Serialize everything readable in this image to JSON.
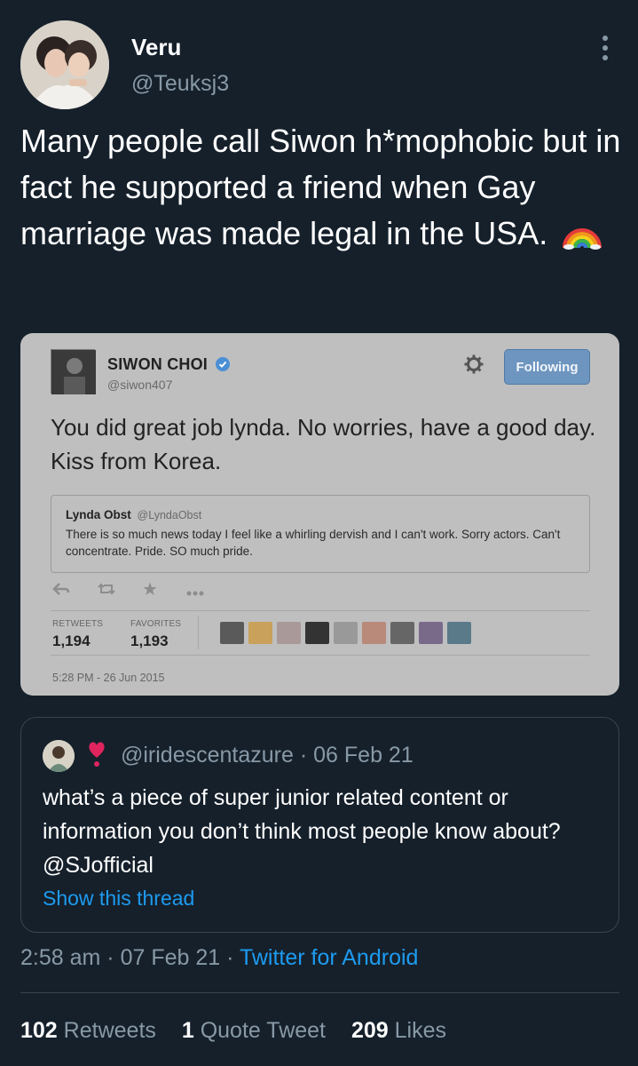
{
  "author": {
    "display_name": "Veru",
    "handle": "@Teuksj3",
    "avatar_icon": "profile-photo-icon"
  },
  "tweet": {
    "text": "Many people call Siwon h*mophobic but in fact he supported a friend when Gay marriage was made legal in the USA.",
    "emoji": "rainbow-icon"
  },
  "embedded_screenshot": {
    "name": "SIWON CHOI",
    "handle": "@siwon407",
    "follow_label": "Following",
    "text": "You did great job lynda. No worries, have a good day. Kiss from Korea.",
    "quote": {
      "name": "Lynda Obst",
      "handle": "@LyndaObst",
      "text": "There is so much news today I feel like a whirling dervish and I can't work. Sorry actors. Can't concentrate. Pride. SO much pride."
    },
    "retweets_label": "RETWEETS",
    "retweets_value": "1,194",
    "favorites_label": "FAVORITES",
    "favorites_value": "1,193",
    "timestamp": "5:28 PM - 26 Jun 2015",
    "face_colors": [
      "#5a5a5a",
      "#c9a15a",
      "#a99",
      "#333",
      "#999",
      "#b9897a",
      "#666",
      "#7a6a8a",
      "#5a7a8a"
    ]
  },
  "quoted_tweet": {
    "handle": "@iridescentazure",
    "date": "06 Feb 21",
    "separator": "·",
    "text": "what’s a piece of super junior related content or information you don’t think most people know about? @SJofficial",
    "show_thread": "Show this thread",
    "heart_color": "#e0245e"
  },
  "meta": {
    "time": "2:58 am",
    "date": "07 Feb 21",
    "separator": "·",
    "client": "Twitter for Android"
  },
  "stats": {
    "retweets_count": "102",
    "retweets_label": "Retweets",
    "quotes_count": "1",
    "quotes_label": "Quote Tweet",
    "likes_count": "209",
    "likes_label": "Likes"
  },
  "colors": {
    "background": "#15202b",
    "secondary_text": "#8899a6",
    "link": "#1d9bf0",
    "border": "#38444d"
  }
}
